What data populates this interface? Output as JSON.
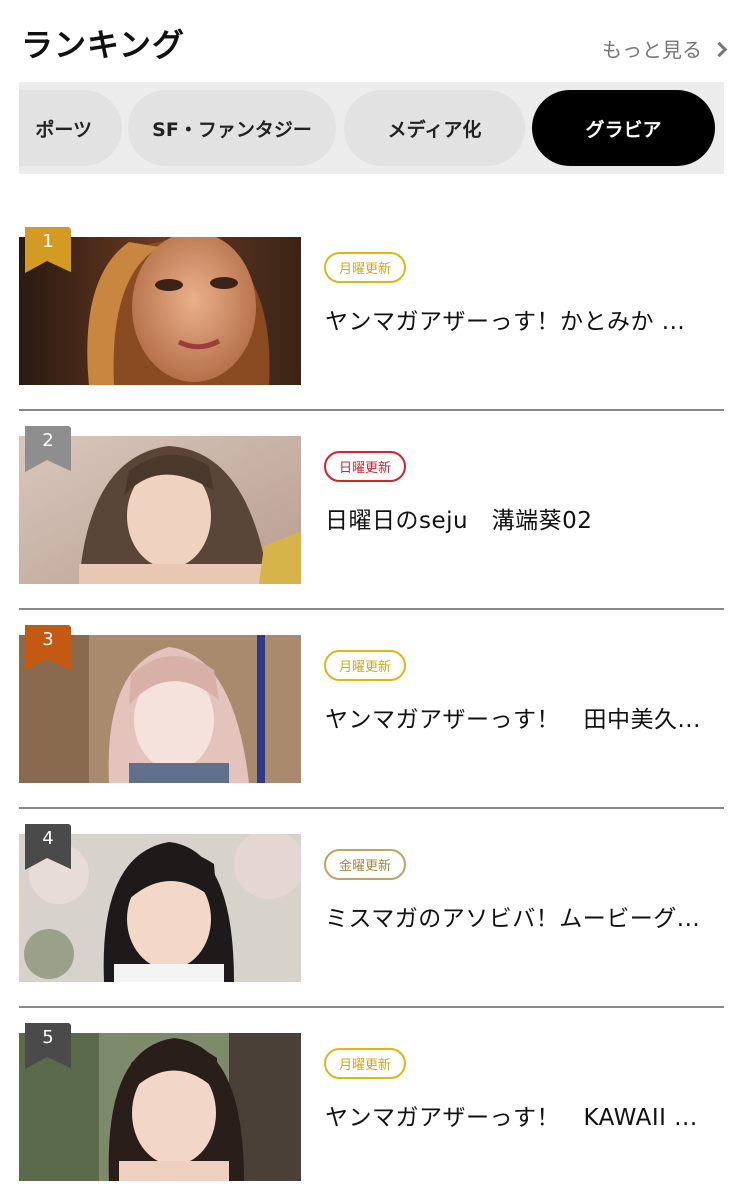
{
  "header": {
    "title": "ランキング",
    "more_label": "もっと見る"
  },
  "tabs": [
    {
      "label": "ポーツ"
    },
    {
      "label": "SF・ファンタジー"
    },
    {
      "label": "メディア化"
    },
    {
      "label": "グラビア",
      "active": true
    }
  ],
  "colors": {
    "gold": "#d49b22",
    "silver": "#8e8e8e",
    "bronze": "#c45a12",
    "dark": "#4a4a4a",
    "badge_yellow": "#e1b515",
    "badge_red": "#d6232b",
    "badge_tan": "#c2a361"
  },
  "ranking": [
    {
      "rank": "1",
      "badge": "月曜更新",
      "title": "ヤンマガアザーっす！かとみか ..."
    },
    {
      "rank": "2",
      "badge": "日曜更新",
      "title": "日曜日のseju　溝端葵02"
    },
    {
      "rank": "3",
      "badge": "月曜更新",
      "title": "ヤンマガアザーっす！　田中美久..."
    },
    {
      "rank": "4",
      "badge": "金曜更新",
      "title": "ミスマガのアソビバ！ムービーグ..."
    },
    {
      "rank": "5",
      "badge": "月曜更新",
      "title": "ヤンマガアザーっす！　KAWAII ..."
    }
  ]
}
